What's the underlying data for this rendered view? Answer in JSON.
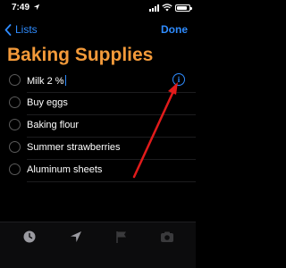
{
  "status_bar": {
    "time": "7:49",
    "location_icon": "location-arrow-icon",
    "signal_icon": "cellular-signal-icon",
    "wifi_icon": "wifi-icon",
    "battery_icon": "battery-icon",
    "battery_level": 0.85
  },
  "nav": {
    "back_icon": "chevron-left-icon",
    "back_label": "Lists",
    "done_label": "Done"
  },
  "list": {
    "title": "Baking Supplies",
    "items": [
      {
        "label": "Milk 2 %",
        "editing": true
      },
      {
        "label": "Buy eggs",
        "editing": false
      },
      {
        "label": "Baking flour",
        "editing": false
      },
      {
        "label": "Summer strawberries",
        "editing": false
      },
      {
        "label": "Aluminum sheets",
        "editing": false
      }
    ],
    "info_button": {
      "glyph": "i",
      "icon": "info-icon"
    }
  },
  "toolbar": {
    "items": [
      "clock-icon",
      "location-arrow-icon",
      "flag-icon",
      "camera-icon"
    ]
  },
  "colors": {
    "accent": "#2f8cff",
    "title": "#f39a3a",
    "annotation_arrow": "#e11b1b",
    "background": "#000000"
  }
}
